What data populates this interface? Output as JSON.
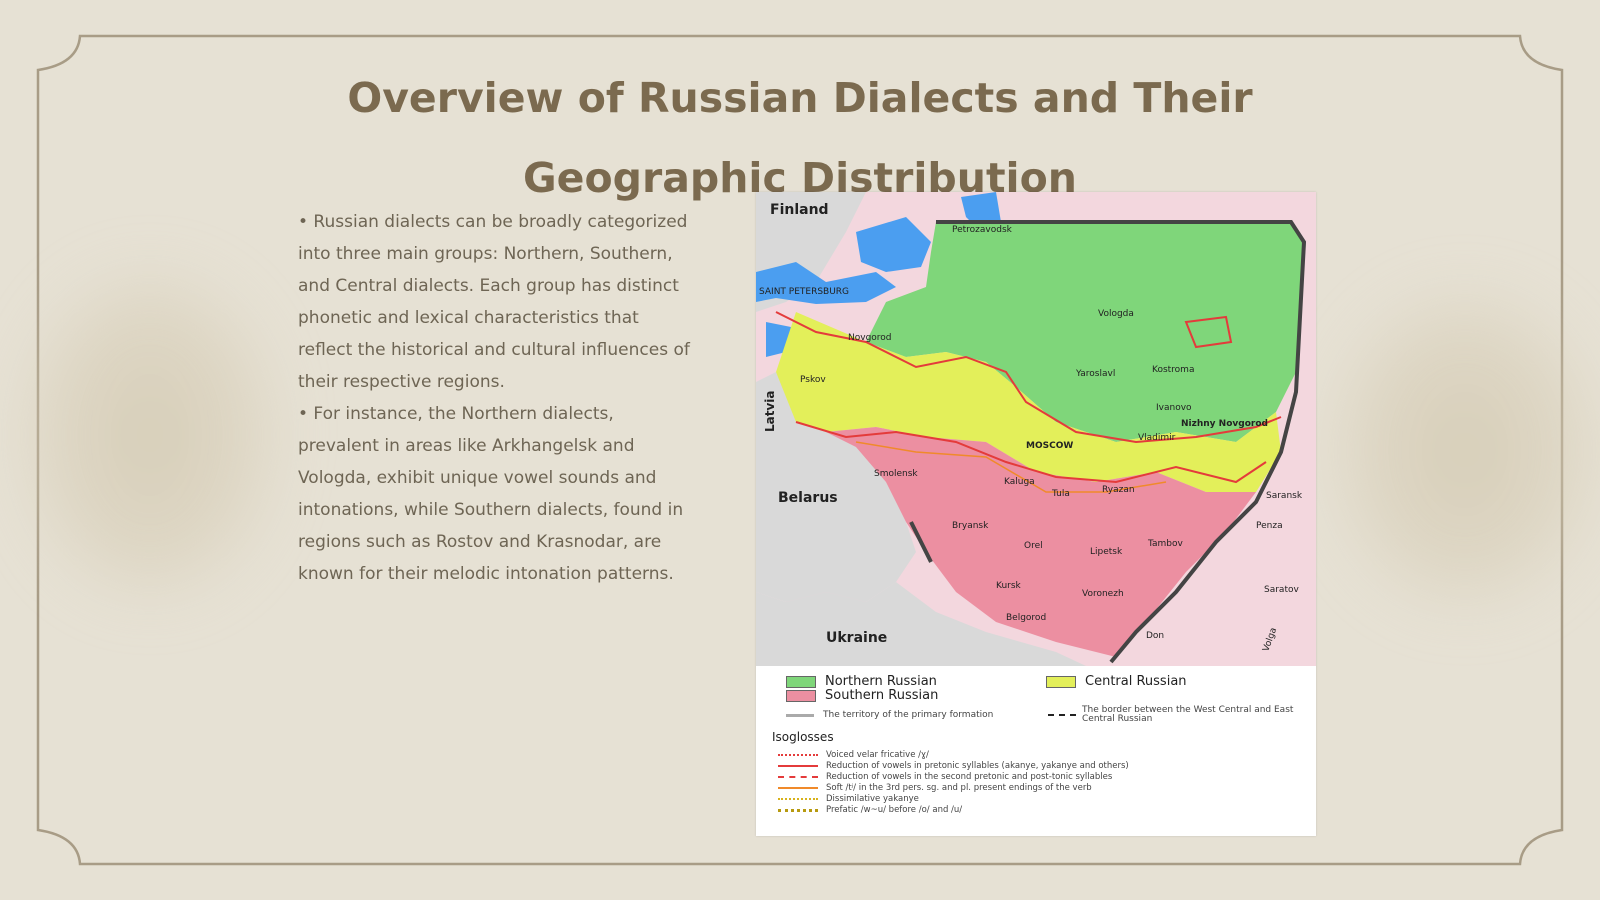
{
  "slide": {
    "title": "Overview of Russian Dialects and Their Geographic Distribution",
    "paragraphs": [
      "• Russian dialects can be broadly categorized into three main groups: Northern, Southern, and Central dialects. Each group has distinct phonetic and lexical characteristics that reflect the historical and cultural influences of their respective regions.",
      "• For instance, the Northern dialects, prevalent in areas like Arkhangelsk and Vologda, exhibit unique vowel sounds and intonations, while Southern dialects, found in regions such as Rostov and Krasnodar, are known for their melodic intonation patterns."
    ]
  },
  "map": {
    "countries": {
      "finland": "Finland",
      "latvia": "Latvia",
      "belarus": "Belarus",
      "ukraine": "Ukraine"
    },
    "cities": {
      "petrozavodsk": "Petrozavodsk",
      "saint_petersburg": "SAINT PETERSBURG",
      "novgorod": "Novgorod",
      "vologda": "Vologda",
      "pskov": "Pskov",
      "yaroslavl": "Yaroslavl",
      "kostroma": "Kostroma",
      "ivanovo": "Ivanovo",
      "nizhny_novgorod": "Nizhny Novgorod",
      "moscow": "MOSCOW",
      "vladimir": "Vladimir",
      "smolensk": "Smolensk",
      "kaluga": "Kaluga",
      "tula": "Tula",
      "ryazan": "Ryazan",
      "saransk": "Saransk",
      "bryansk": "Bryansk",
      "penza": "Penza",
      "orel": "Orel",
      "lipetsk": "Lipetsk",
      "tambov": "Tambov",
      "kursk": "Kursk",
      "voronezh": "Voronezh",
      "saratov": "Saratov",
      "belgorod": "Belgorod",
      "don": "Don",
      "volga": "Volga"
    },
    "legend": {
      "northern": "Northern Russian",
      "southern": "Southern Russian",
      "central": "Central Russian",
      "primary_territory": "The territory of the primary formation",
      "border_note": "The border between the West Central and East Central Russian",
      "isoglosses_heading": "Isoglosses",
      "isoglosses": [
        "Voiced velar fricative /ɣ/",
        "Reduction of vowels in pretonic syllables (akanye, yakanye and others)",
        "Reduction of vowels in the second pretonic and post-tonic syllables",
        "Soft /tʲ/ in the 3rd pers. sg. and pl. present endings of the verb",
        "Dissimilative yakanye",
        "Prefatic /w~u/ before /o/ and /u/"
      ]
    },
    "colors": {
      "northern": "#7fd67a",
      "central": "#e3ef5a",
      "southern": "#ec8fa1",
      "outside_russia": "#d9d9d9",
      "outside_region": "#f3d7de",
      "water": "#4b9ef0",
      "isogloss_red": "#e43b3b",
      "isogloss_orange": "#f08a2a",
      "isogloss_yellow": "#d8b21a"
    }
  }
}
